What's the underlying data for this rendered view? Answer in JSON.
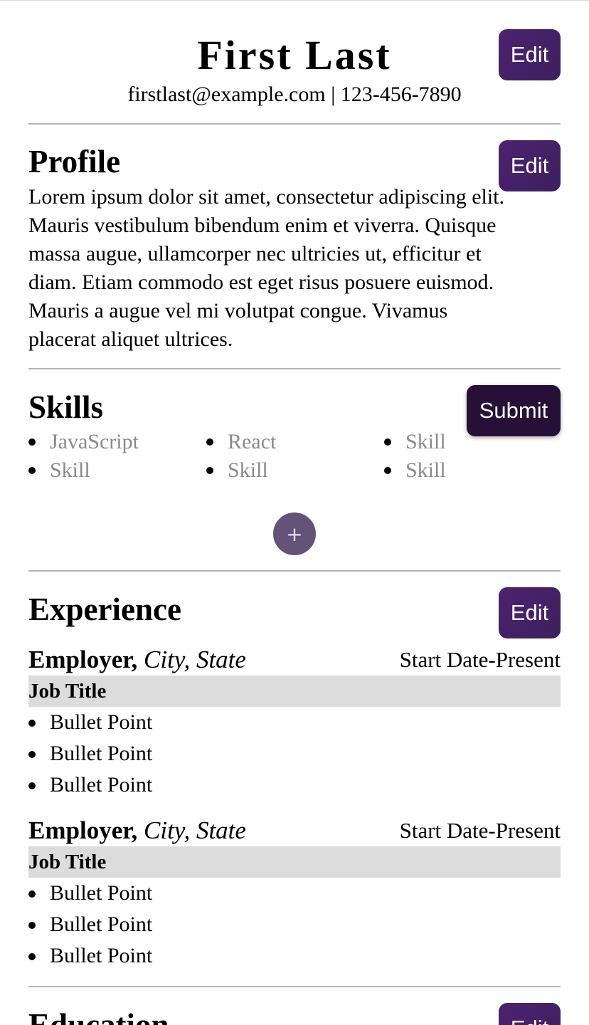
{
  "header": {
    "name": "First Last",
    "contact": "firstlast@example.com | 123-456-7890",
    "edit_label": "Edit"
  },
  "profile": {
    "title": "Profile",
    "edit_label": "Edit",
    "text": "Lorem ipsum dolor sit amet, consectetur adipiscing elit. Mauris vestibulum bibendum enim et viverra. Quisque massa augue, ullamcorper nec ultricies ut, efficitur et diam. Etiam commodo est eget risus posuere euismod. Mauris a augue vel mi volutpat congue. Vivamus placerat aliquet ultrices."
  },
  "skills": {
    "title": "Skills",
    "submit_label": "Submit",
    "add_label": "+",
    "items": [
      "JavaScript",
      "React",
      "Skill",
      "Skill",
      "Skill",
      "Skill"
    ]
  },
  "experience": {
    "title": "Experience",
    "edit_label": "Edit",
    "jobs": [
      {
        "employer": "Employer,",
        "location": "City, State",
        "dates": "Start Date-Present",
        "title": "Job Title",
        "bullets": [
          "Bullet Point",
          "Bullet Point",
          "Bullet Point"
        ]
      },
      {
        "employer": "Employer,",
        "location": "City, State",
        "dates": "Start Date-Present",
        "title": "Job Title",
        "bullets": [
          "Bullet Point",
          "Bullet Point",
          "Bullet Point"
        ]
      }
    ]
  },
  "education": {
    "title": "Education",
    "edit_label": "Edit"
  },
  "colors": {
    "accent": "#4b2370",
    "submit": "#271037",
    "add_button": "#645278",
    "job_title_bg": "#dcdcdc",
    "skill_text": "#8a8a8a"
  }
}
